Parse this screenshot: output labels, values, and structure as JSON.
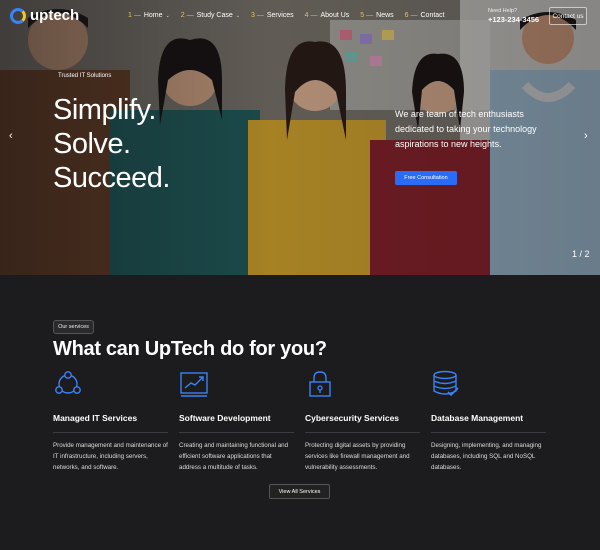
{
  "brand": {
    "name": "uptech"
  },
  "nav": {
    "items": [
      {
        "num": "1 —",
        "label": "Home",
        "caret": "⌄"
      },
      {
        "num": "2 —",
        "label": "Study Case",
        "caret": "⌄"
      },
      {
        "num": "3 —",
        "label": "Services",
        "caret": ""
      },
      {
        "num": "4 —",
        "label": "About Us",
        "caret": ""
      },
      {
        "num": "5 —",
        "label": "News",
        "caret": ""
      },
      {
        "num": "6 —",
        "label": "Contact",
        "caret": ""
      }
    ]
  },
  "header": {
    "help": "Need Help?",
    "phone": "+123-234-3456",
    "contact_label": "Contact us"
  },
  "hero": {
    "tag": "Trusted IT Solutions",
    "headline": [
      "Simplify.",
      "Solve.",
      "Succeed."
    ],
    "description": "We are team of tech enthusiasts dedicated to taking your technology aspirations to new heights.",
    "button_label": "Free Consultation",
    "prev_arrow": "‹",
    "next_arrow": "›",
    "slide_counter": "1 / 2"
  },
  "services": {
    "tag": "Our services",
    "title": "What can UpTech do for you?",
    "view_all_label": "View All Services",
    "accent": "#3b82f6",
    "cards": [
      {
        "icon": "network-icon",
        "title": "Managed IT Services",
        "description": "Provide management and maintenance of IT infrastructure, including servers, networks, and software."
      },
      {
        "icon": "chart-growth-icon",
        "title": "Software Development",
        "description": "Creating and maintaining functional and efficient software applications that address a multitude of tasks."
      },
      {
        "icon": "padlock-icon",
        "title": "Cybersecurity Services",
        "description": "Protecting digital assets by providing services like firewall management and vulnerability assessments."
      },
      {
        "icon": "database-check-icon",
        "title": "Database Management",
        "description": "Designing, implementing, and managing databases, including SQL and NoSQL databases."
      }
    ]
  }
}
